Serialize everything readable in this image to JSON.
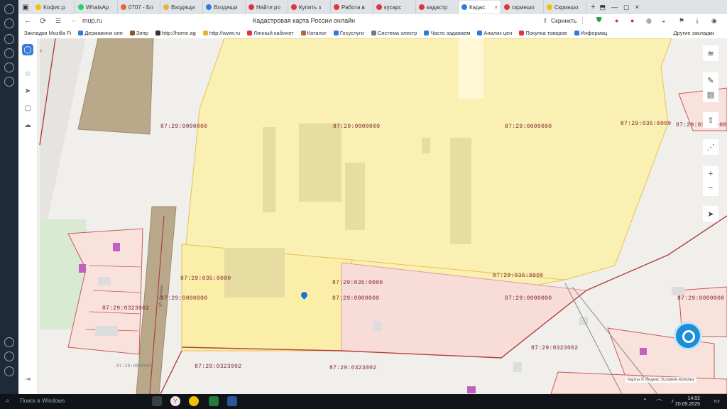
{
  "browser": {
    "tabs": [
      {
        "label": "Кофис.р",
        "color": "#f2c200"
      },
      {
        "label": "WhatsAp",
        "color": "#25d366"
      },
      {
        "label": "0707 - Бл",
        "color": "#e06a2a"
      },
      {
        "label": "Входящи",
        "color": "#e3b53a"
      },
      {
        "label": "Входящи",
        "color": "#2e7be0"
      },
      {
        "label": "Найти ро",
        "color": "#e0343a"
      },
      {
        "label": "Купить з",
        "color": "#e0343a"
      },
      {
        "label": "Работа в",
        "color": "#e0343a"
      },
      {
        "label": "кусарс",
        "color": "#e0343a"
      },
      {
        "label": "кадастр",
        "color": "#e0343a"
      },
      {
        "label": "Кадас",
        "color": "#2e7be0",
        "active": true
      },
      {
        "label": "скриншо",
        "color": "#e0343a"
      },
      {
        "label": "Скриншо",
        "color": "#f2c200"
      }
    ],
    "url": "mup.ru",
    "page_title": "Кадастровая карта России онлайн",
    "bookmarks": [
      {
        "label": "Закладки Mozilla Fi",
        "color": "#999999"
      },
      {
        "label": "Державини олп",
        "color": "#2e7be0"
      },
      {
        "label": "Зипр",
        "color": "#8a5a2a"
      },
      {
        "label": "http://home.ag",
        "color": "#333333"
      },
      {
        "label": "http://www.ru",
        "color": "#e3b53a"
      },
      {
        "label": "Личный кабинет",
        "color": "#e0343a"
      },
      {
        "label": "Каталог",
        "color": "#b36a3a"
      },
      {
        "label": "Госуслуги",
        "color": "#2e7be0"
      },
      {
        "label": "Система электр",
        "color": "#777777"
      },
      {
        "label": "Часто задаваем",
        "color": "#2e7be0"
      },
      {
        "label": "Анализ цен",
        "color": "#2e7be0"
      },
      {
        "label": "Покупка товаров",
        "color": "#e0343a"
      },
      {
        "label": "Информац",
        "color": "#2e7be0"
      },
      {
        "label": "Другие закладки",
        "color": "#999999"
      }
    ],
    "toolbar_action": "Скринкть"
  },
  "map": {
    "parcel_labels": [
      {
        "text": "87:29:0000000"
      },
      {
        "text": "87:29:0000000"
      },
      {
        "text": "87:29:0000000"
      },
      {
        "text": "87:29:035:0000"
      },
      {
        "text": "87:29:035:0000"
      },
      {
        "text": "87:29:035:0000"
      },
      {
        "text": "87:29:035:0000"
      },
      {
        "text": "87:29:0000000"
      },
      {
        "text": "87:29:0000000"
      },
      {
        "text": "87:29:0000000"
      },
      {
        "text": "87:29:0323002"
      },
      {
        "text": "87:29:0000000"
      },
      {
        "text": "87:29:0323002"
      },
      {
        "text": "87:29:0323002"
      },
      {
        "text": "87:29:0323002"
      },
      {
        "text": "87:29:035:0000"
      },
      {
        "text": "87:29:0000000"
      }
    ],
    "attribution": "Карты © Яндекс Условия использ",
    "road_label": "ул. Ленина"
  },
  "taskbar": {
    "search_placeholder": "Поиск в Windows",
    "time": "14:02",
    "date": "20.05.2025"
  }
}
